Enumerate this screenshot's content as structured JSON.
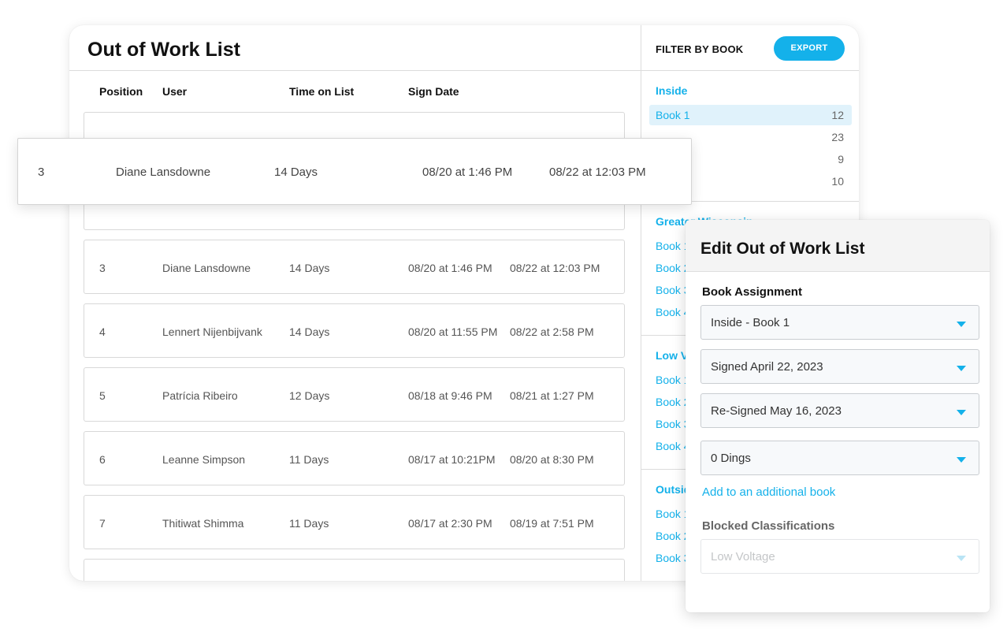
{
  "list": {
    "title": "Out of Work List",
    "columns": [
      "Position",
      "User",
      "Time on List",
      "Sign Date"
    ],
    "rows": [
      {
        "position": "3",
        "user": "Diane Lansdowne",
        "time": "14 Days",
        "sign": "08/20 at 1:46 PM",
        "resign": "08/22 at 12:03 PM"
      },
      {
        "position": "4",
        "user": "Lennert Nijenbijvank",
        "time": "14 Days",
        "sign": "08/20 at 11:55 PM",
        "resign": "08/22 at 2:58 PM"
      },
      {
        "position": "5",
        "user": "Patrícia Ribeiro",
        "time": "12 Days",
        "sign": "08/18 at 9:46 PM",
        "resign": "08/21 at 1:27 PM"
      },
      {
        "position": "6",
        "user": "Leanne Simpson",
        "time": "11 Days",
        "sign": "08/17 at 10:21PM",
        "resign": "08/20 at 8:30 PM"
      },
      {
        "position": "7",
        "user": "Thitiwat Shimma",
        "time": "11 Days",
        "sign": "08/17 at 2:30 PM",
        "resign": "08/19 at 7:51 PM"
      }
    ]
  },
  "drag_row": {
    "position": "3",
    "user": "Diane Lansdowne",
    "time": "14 Days",
    "sign": "08/20 at 1:46 PM",
    "resign": "08/22 at 12:03 PM"
  },
  "filter": {
    "title": "FILTER BY BOOK",
    "export_label": "EXPORT",
    "groups": [
      {
        "name": "Inside",
        "books": [
          {
            "label": "Book 1",
            "count": "12",
            "active": true
          },
          {
            "label": "",
            "count": "23"
          },
          {
            "label": "",
            "count": "9"
          },
          {
            "label": "",
            "count": "10"
          }
        ]
      },
      {
        "name": "Greater Wisconsin",
        "books": [
          {
            "label": "Book 1"
          },
          {
            "label": "Book 2"
          },
          {
            "label": "Book 3"
          },
          {
            "label": "Book 4"
          }
        ]
      },
      {
        "name": "Low Voltage",
        "books": [
          {
            "label": "Book 1"
          },
          {
            "label": "Book 2"
          },
          {
            "label": "Book 3"
          },
          {
            "label": "Book 4"
          }
        ]
      },
      {
        "name": "Outside",
        "books": [
          {
            "label": "Book 1"
          },
          {
            "label": "Book 2"
          },
          {
            "label": "Book 3"
          }
        ]
      }
    ]
  },
  "edit": {
    "title": "Edit Out of Work List",
    "book_assignment_label": "Book Assignment",
    "book_select": "Inside - Book 1",
    "signed_select": "Signed April 22, 2023",
    "resigned_select": "Re-Signed May 16, 2023",
    "dings_select": "0 Dings",
    "add_link": "Add to an additional book",
    "blocked_label": "Blocked Classifications",
    "blocked_select": "Low Voltage"
  },
  "colors": {
    "accent": "#14b1ea",
    "active_bg": "#e0f2fb"
  }
}
